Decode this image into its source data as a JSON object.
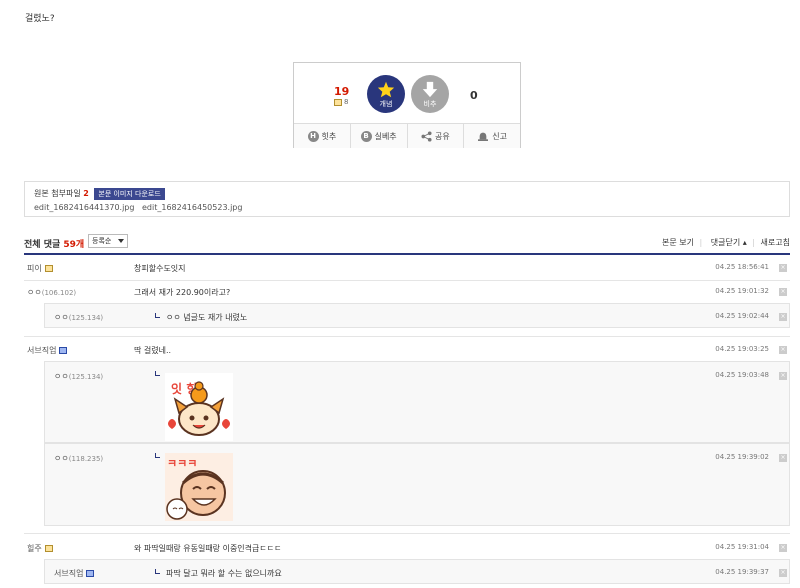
{
  "post": {
    "text": "걸렸노?"
  },
  "vote": {
    "up_count": "19",
    "fix_count": "8",
    "up_label": "개념",
    "down_label": "비추",
    "down_count": "0",
    "actions": [
      "힛추",
      "실베추",
      "공유",
      "신고"
    ]
  },
  "attach": {
    "title": "원본 첨부파일",
    "count": "2",
    "download": "본문 이미지 다운로드",
    "files": [
      "edit_1682416441370.jpg",
      "edit_1682416450523.jpg"
    ]
  },
  "comments_header": {
    "total_label": "전체 댓글",
    "total_count": "59개",
    "sort": "등록순",
    "view_post": "본문 보기",
    "close_comments": "댓글닫기",
    "refresh": "새로고침"
  },
  "comments": [
    {
      "nick": "피이",
      "text": "창피할수도잇지",
      "date": "04.25 18:56:41"
    },
    {
      "nick": "ㅇㅇ",
      "ip": "(106.102)",
      "text": "그래서 재가 220.90이라고?",
      "date": "04.25 19:01:32"
    },
    {
      "nick": "ㅇㅇ",
      "ip": "(125.134)",
      "text": "ㅇㅇ 념글도 재가 내렸노",
      "date": "04.25 19:02:44"
    },
    {
      "nick": "서브직업",
      "text": "딱 걸렸네..",
      "date": "04.25 19:03:25"
    },
    {
      "nick": "ㅇㅇ",
      "ip": "(125.134)",
      "text": "",
      "date": "04.25 19:03:48",
      "sticker_text": "잇 힝"
    },
    {
      "nick": "ㅇㅇ",
      "ip": "(118.235)",
      "text": "",
      "date": "04.25 19:39:02",
      "sticker_text": "ㅋㅋㅋ"
    },
    {
      "nick": "힐주",
      "text": "와 파딱일때랑 유동일때랑 이중인격급ㄷㄷㄷ",
      "date": "04.25 19:31:04"
    },
    {
      "nick": "서브직업",
      "text": "파딱 달고 뭐라 할 수는 없으니까요",
      "date": "04.25 19:39:37"
    }
  ],
  "colors": {
    "accent": "#29367c",
    "red": "#d31900"
  }
}
